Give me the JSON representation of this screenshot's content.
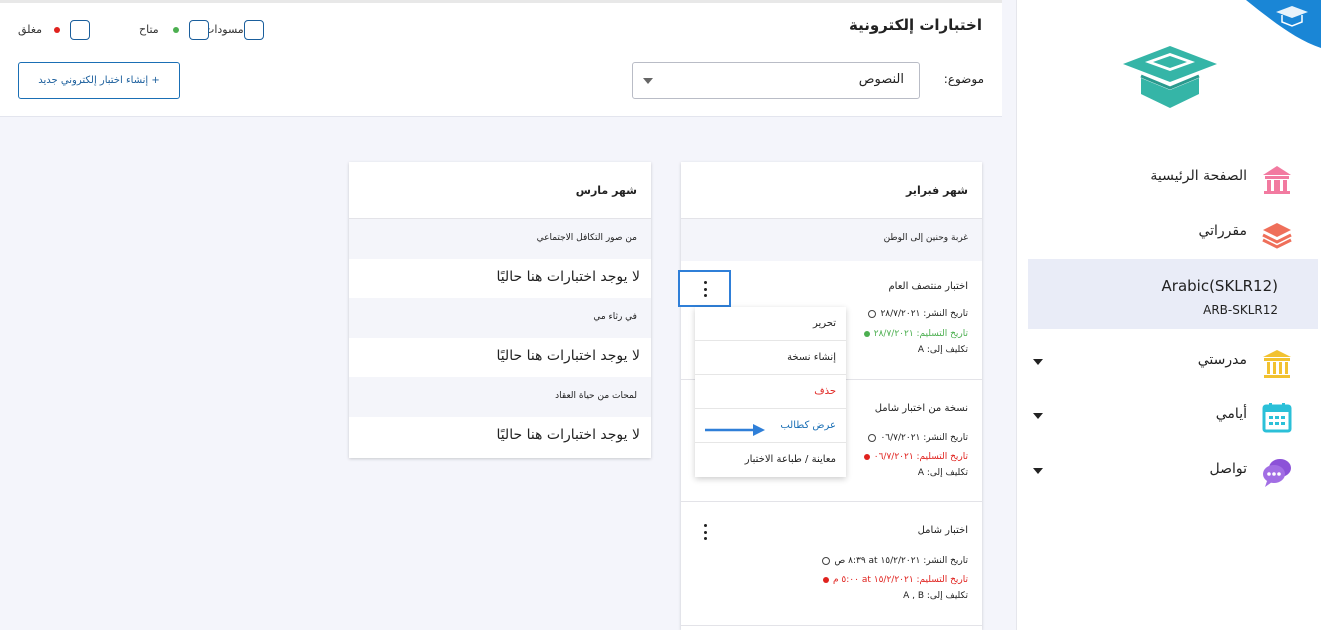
{
  "header": {
    "title": "اختبارات إلكترونية",
    "filters": [
      {
        "label": "مسودات",
        "dot_color": ""
      },
      {
        "label": "متاح",
        "dot_color": "#4caf50"
      },
      {
        "label": "مغلق",
        "dot_color": "#e0221e"
      }
    ],
    "topic_label": "موضوع:",
    "topic_value": "النصوص",
    "create_label": "+ إنشاء اختبار إلكتروني جديد"
  },
  "february": {
    "title": "شهر فبراير",
    "section": "غربة وحنين إلى الوطن",
    "exams": [
      {
        "title": "اختبار منتصف العام",
        "publish": "تاريخ النشر: ٢٨/٧/٢٠٢١",
        "due": "تاريخ التسليم: ٢٨/٧/٢٠٢١",
        "due_color": "#4caf50",
        "assigned": "تكليف إلى: A"
      },
      {
        "title": "نسخة من اختبار شامل",
        "publish": "تاريخ النشر: ٠٦/٧/٢٠٢١",
        "due": "تاريخ التسليم: ٠٦/٧/٢٠٢١",
        "due_color": "#e0221e",
        "assigned": "تكليف إلى: A"
      },
      {
        "title": "اختبار شامل",
        "publish": "تاريخ النشر: ١٥/٢/٢٠٢١ at ٨:٣٩ ص",
        "due": "تاريخ التسليم: ١٥/٢/٢٠٢١ at ٥:٠٠ م",
        "due_color": "#e0221e",
        "assigned": "تكليف إلى: A , B"
      }
    ]
  },
  "march": {
    "title": "شهر مارس",
    "sections": [
      {
        "title": "من صور التكافل الاجتماعي",
        "empty": "لا يوجد اختبارات هنا حاليًا"
      },
      {
        "title": "في رثاء مي",
        "empty": "لا يوجد اختبارات هنا حاليًا"
      },
      {
        "title": "لمحات من حياة العقاد",
        "empty": "لا يوجد اختبارات هنا حاليًا"
      }
    ]
  },
  "menu": {
    "items": [
      {
        "label": "تحرير",
        "color": "#222"
      },
      {
        "label": "إنشاء نسخة",
        "color": "#222"
      },
      {
        "label": "حذف",
        "color": "#e0221e"
      },
      {
        "label": "عرض كطالب",
        "color": "#1a6fb5"
      },
      {
        "label": "معاينة / طباعة الاختبار",
        "color": "#222"
      }
    ]
  },
  "sidebar": {
    "items": [
      {
        "label": "الصفحة الرئيسية",
        "icon": "home-icon"
      },
      {
        "label": "مقرراتي",
        "icon": "books-icon"
      },
      {
        "label": "مدرستي",
        "icon": "school-icon"
      },
      {
        "label": "أيامي",
        "icon": "calendar-icon"
      },
      {
        "label": "تواصل",
        "icon": "chat-icon"
      }
    ],
    "course": {
      "name": "Arabic(SKLR12)",
      "code": "ARB-SKLR12"
    }
  },
  "colors": {
    "accent": "#1a6fb5",
    "logo_teal": "#35b5a7",
    "home_pink": "#f27aa0",
    "books_coral": "#ef6f5a",
    "school_gold": "#f2c230",
    "calendar_cyan": "#2bc0d8",
    "chat_purple": "#8c52d8"
  }
}
